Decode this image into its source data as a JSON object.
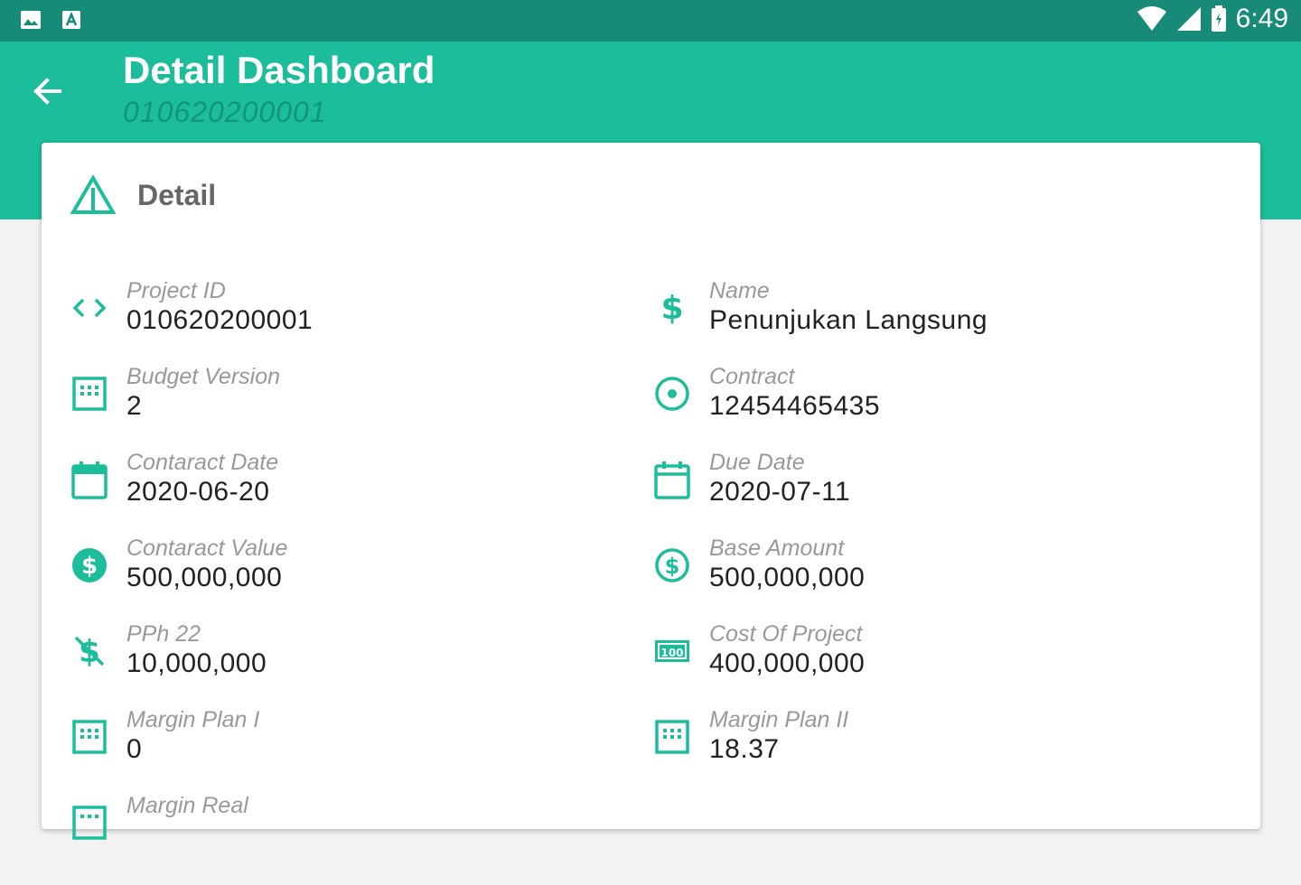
{
  "status_bar": {
    "time": "6:49",
    "icons": [
      "image-icon",
      "a-icon",
      "wifi-icon",
      "signal-icon",
      "battery-icon"
    ]
  },
  "app_bar": {
    "title": "Detail Dashboard",
    "subtitle": "010620200001",
    "color": "#1cbd9b"
  },
  "card": {
    "title": "Detail",
    "fields": [
      {
        "label": "Project ID",
        "value": "010620200001",
        "icon": "code-icon"
      },
      {
        "label": "Name",
        "value": "Penunjukan Langsung",
        "icon": "dollar-icon"
      },
      {
        "label": "Budget Version",
        "value": "2",
        "icon": "grid-icon"
      },
      {
        "label": "Contract",
        "value": "12454465435",
        "icon": "target-icon"
      },
      {
        "label": "Contaract Date",
        "value": "2020-06-20",
        "icon": "calendar-icon"
      },
      {
        "label": "Due Date",
        "value": "2020-07-11",
        "icon": "calendar-icon"
      },
      {
        "label": "Contaract Value",
        "value": "500,000,000",
        "icon": "dollar-circle-filled-icon"
      },
      {
        "label": "Base Amount",
        "value": "500,000,000",
        "icon": "dollar-circle-outline-icon"
      },
      {
        "label": "PPh 22",
        "value": "10,000,000",
        "icon": "money-off-icon"
      },
      {
        "label": "Cost Of Project",
        "value": "400,000,000",
        "icon": "banknote-100-icon"
      },
      {
        "label": "Margin Plan I",
        "value": "0",
        "icon": "grid-icon"
      },
      {
        "label": "Margin Plan II",
        "value": "18.37",
        "icon": "grid-icon"
      },
      {
        "label": "Margin Real",
        "value": "",
        "icon": "grid-icon"
      }
    ]
  },
  "colors": {
    "accent": "#1cbd9b",
    "status_bar": "#178a78",
    "subtitle": "#13957a",
    "label": "#999999",
    "value": "#222222"
  }
}
